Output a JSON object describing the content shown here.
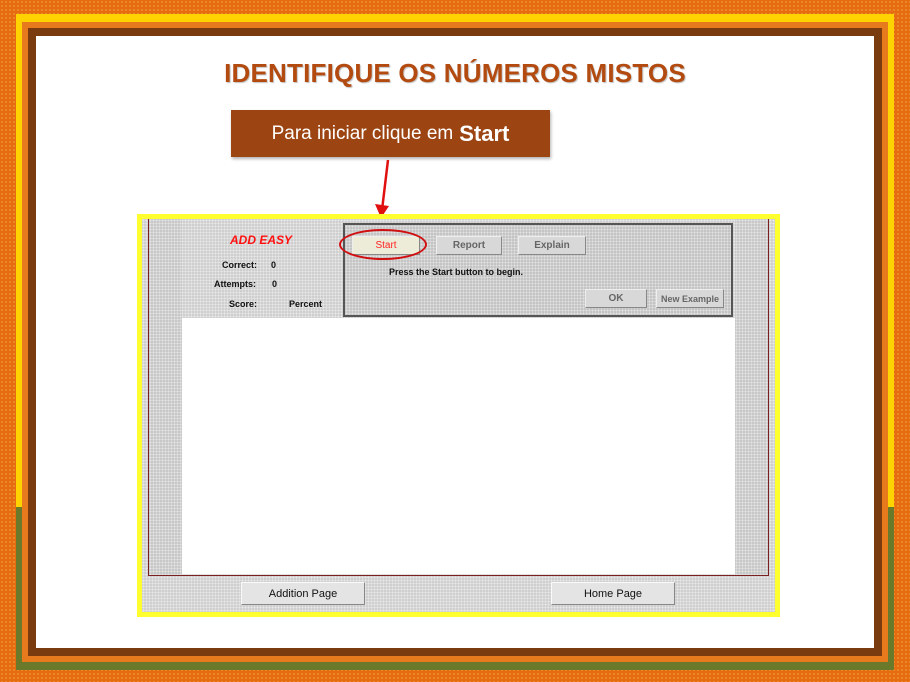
{
  "slide": {
    "title": "IDENTIFIQUE OS NÚMEROS MISTOS",
    "callout_prefix": "Para iniciar clique em",
    "callout_emphasis": "Start",
    "arrow_color": "#e01010"
  },
  "applet": {
    "mode_label": "ADD EASY",
    "stats": {
      "correct_label": "Correct:",
      "correct_value": "0",
      "attempts_label": "Attempts:",
      "attempts_value": "0",
      "score_label": "Score:",
      "score_value": "Percent"
    },
    "panel": {
      "start_label": "Start",
      "report_label": "Report",
      "explain_label": "Explain",
      "message": "Press the Start button to begin.",
      "ok_label": "OK",
      "new_example_label": "New Example"
    },
    "nav": {
      "addition_label": "Addition Page",
      "home_label": "Home Page"
    }
  },
  "colors": {
    "title": "#b34a10",
    "callout_bg": "#9c4513",
    "mode_label": "#ff1010",
    "applet_border": "#ffff30"
  }
}
